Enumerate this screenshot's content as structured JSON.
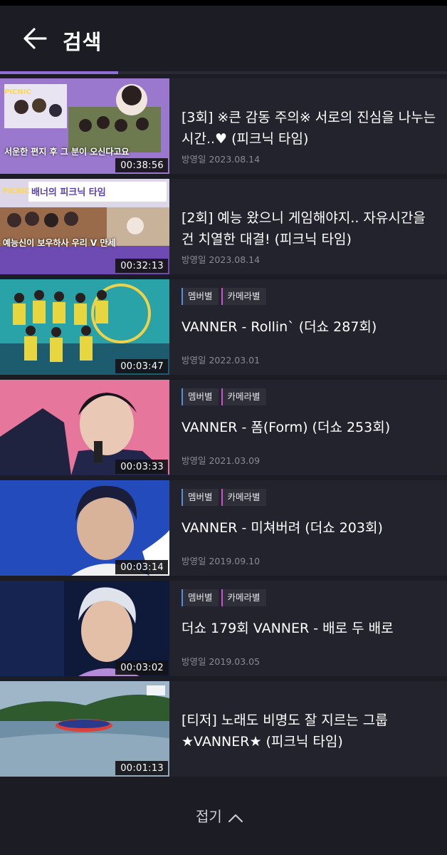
{
  "header": {
    "title": "검색",
    "back_icon": "arrow-left-icon"
  },
  "progress": {
    "fraction": 0.265
  },
  "results": [
    {
      "title": "[3회] ※큰 감동 주의※ 서로의 진심을 나누는 시간..♥ (피크닉 타임)",
      "date": "방영일 2023.08.14",
      "duration": "00:38:56",
      "thumb_caption": "서운한 편지 후 그 분이 오신다고요"
    },
    {
      "title": "[2회] 예능 왔으니 게임해야지.. 자유시간을 건 치열한 대결! (피크닉 타임)",
      "date": "방영일 2023.08.14",
      "duration": "00:32:13",
      "thumb_caption": "예능신이 보우하사 우리 V 만세",
      "thumb_banner": "배너의 피크닉 타임"
    },
    {
      "tags": [
        "멤버별",
        "카메라별"
      ],
      "title": "VANNER - Rollin` (더쇼 287회)",
      "date": "방영일 2022.03.01",
      "duration": "00:03:47"
    },
    {
      "tags": [
        "멤버별",
        "카메라별"
      ],
      "title": "VANNER - 폼(Form) (더쇼 253회)",
      "date": "방영일 2021.03.09",
      "duration": "00:03:33"
    },
    {
      "tags": [
        "멤버별",
        "카메라별"
      ],
      "title": "VANNER - 미쳐버려 (더쇼 203회)",
      "date": "방영일 2019.09.10",
      "duration": "00:03:14"
    },
    {
      "tags": [
        "멤버별",
        "카메라별"
      ],
      "title": "더쇼 179회 VANNER - 배로 두 배로",
      "date": "방영일 2019.03.05",
      "duration": "00:03:02"
    },
    {
      "title": "[티저] 노래도 비명도 잘 지르는 그룹 ★VANNER★ (피크닉 타임)",
      "date": "",
      "duration": "00:01:13"
    }
  ],
  "footer": {
    "fold_label": "접기",
    "fold_icon": "chevron-up-icon"
  },
  "colors": {
    "background": "#1c1c24",
    "card": "#23232d",
    "accent": "#8f6fd8",
    "member_tag": "#5a8fe0",
    "camera_tag": "#d04fd0"
  }
}
